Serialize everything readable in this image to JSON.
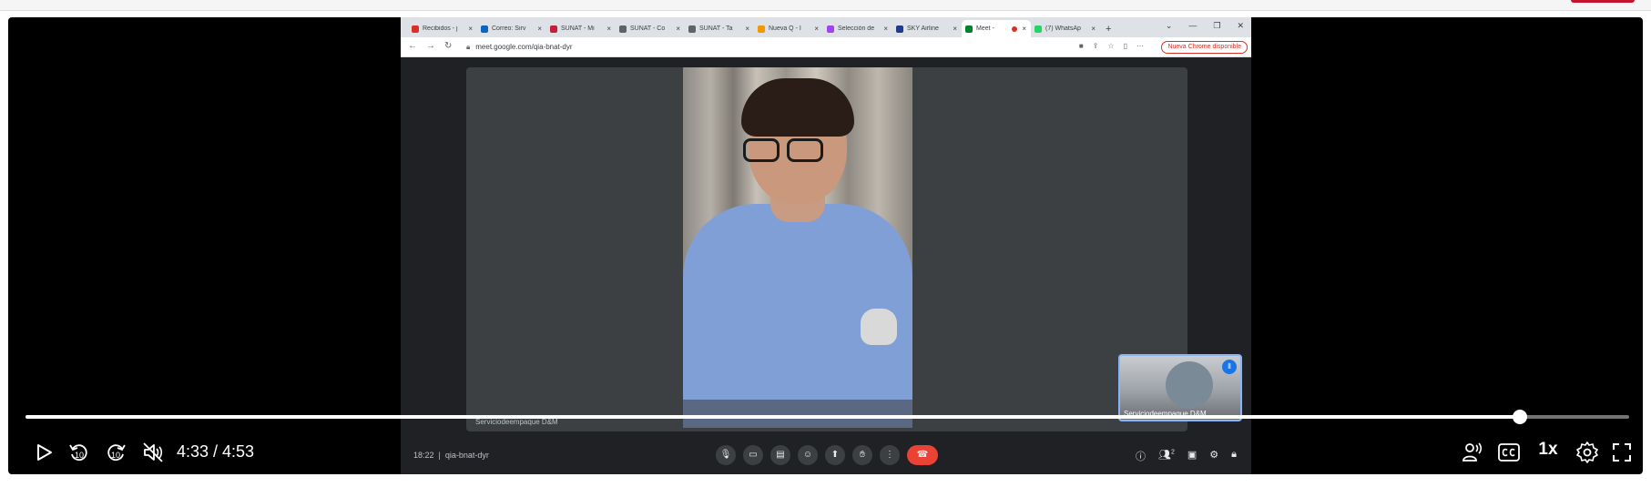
{
  "browser_tabs": [
    {
      "label": "Recibidos - j",
      "color": "#d93025"
    },
    {
      "label": "Correo: Sirv",
      "color": "#0a66c2"
    },
    {
      "label": "SUNAT - Mi",
      "color": "#c41e3a"
    },
    {
      "label": "SUNAT - Co",
      "color": "#5f6368"
    },
    {
      "label": "SUNAT - Ta",
      "color": "#5f6368"
    },
    {
      "label": "Nueva Q - I",
      "color": "#f29900"
    },
    {
      "label": "Selección de",
      "color": "#a142f4"
    },
    {
      "label": "SKY Airline",
      "color": "#1e3a8a"
    },
    {
      "label": "Meet - ",
      "color": "#00832d",
      "active": true
    },
    {
      "label": "(7) WhatsAp",
      "color": "#25d366"
    }
  ],
  "browser": {
    "url": "meet.google.com/qia-bnat-dyr",
    "update_label": "Nueva Chrome disponible"
  },
  "meet": {
    "speaker_name": "Serviciodeempaque D&M",
    "self_label": "Serviciodeempaque D&M",
    "clock": "18:22",
    "meeting_code": "qia-bnat-dyr",
    "participants_count": "2"
  },
  "player": {
    "time_display": "4:33 / 4:53",
    "current_seconds": 273,
    "duration_seconds": 293,
    "speed_label": "1x",
    "muted": true,
    "skip_back_seconds": "10",
    "skip_forward_seconds": "10"
  },
  "icons": {
    "play": "play-icon",
    "rewind": "rewind-10-icon",
    "forward": "forward-10-icon",
    "mute": "volume-muted-icon",
    "transcript": "transcript-icon",
    "captions": "cc-icon",
    "settings": "gear-icon",
    "fullscreen": "fullscreen-icon"
  }
}
